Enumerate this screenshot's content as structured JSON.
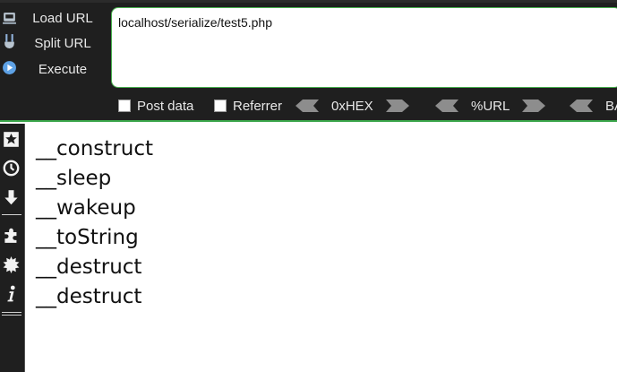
{
  "toolbar": {
    "commands": [
      {
        "label": "Load URL",
        "icon": "load-url-icon"
      },
      {
        "label": "Split URL",
        "icon": "split-url-icon"
      },
      {
        "label": "Execute",
        "icon": "execute-icon"
      }
    ],
    "url_value": "localhost/serialize/test5.php",
    "options": {
      "post_data": {
        "label": "Post data",
        "checked": false
      },
      "referrer": {
        "label": "Referrer",
        "checked": false
      }
    },
    "encoders": [
      "0xHEX",
      "%URL",
      "BA"
    ]
  },
  "sidebar": {
    "icons": [
      "bookmark-star-icon",
      "history-clock-icon",
      "download-arrow-icon",
      "addons-puzzle-icon",
      "settings-gear-icon",
      "info-icon"
    ]
  },
  "output": {
    "lines": [
      "__construct",
      "__sleep",
      "__wakeup",
      "__toString",
      "__destruct",
      "__destruct"
    ]
  },
  "colors": {
    "toolbar_bg": "#1f1f1f",
    "accent_green": "#3aa64a",
    "text_light": "#e8e8e8",
    "content_bg": "#ffffff"
  }
}
